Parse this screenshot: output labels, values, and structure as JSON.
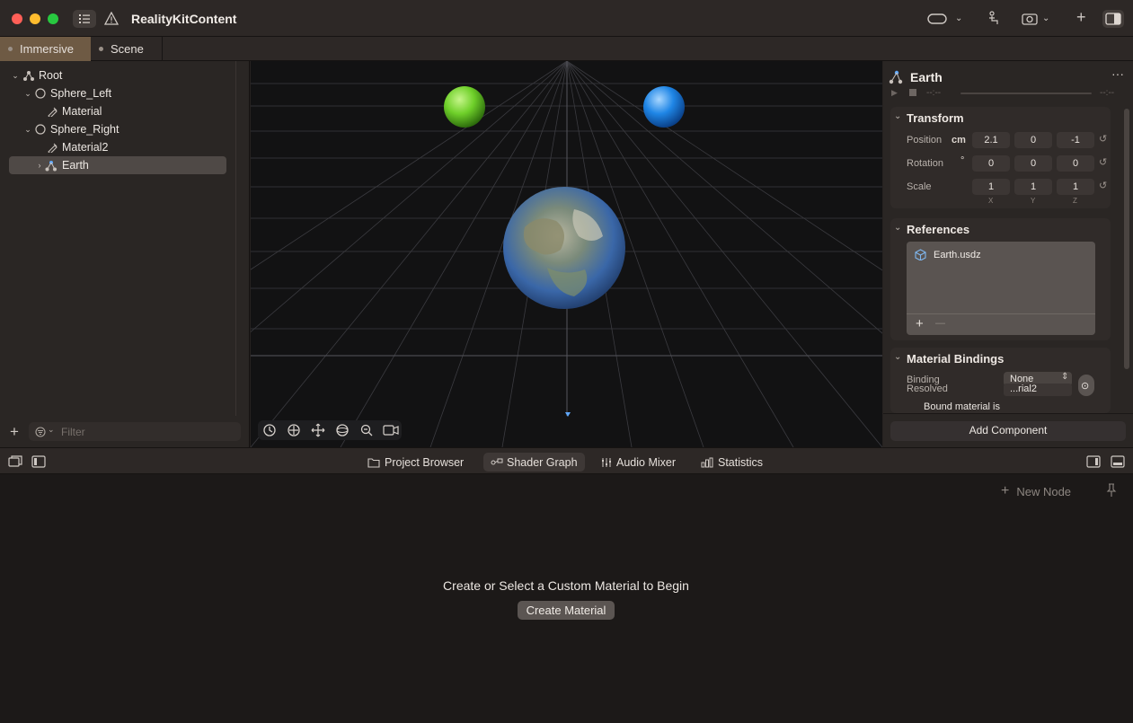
{
  "titlebar": {
    "title": "RealityKitContent",
    "traffic_colors": [
      "#ff5f57",
      "#febc2e",
      "#28c840"
    ]
  },
  "tabs": [
    {
      "label": "Immersive",
      "active": true
    },
    {
      "label": "Scene",
      "active": false
    }
  ],
  "hierarchy": {
    "items": [
      {
        "label": "Root",
        "icon": "entity-icon",
        "depth": 0,
        "expanded": true
      },
      {
        "label": "Sphere_Left",
        "icon": "sphere-icon",
        "depth": 1,
        "expanded": true
      },
      {
        "label": "Material",
        "icon": "material-icon",
        "depth": 2
      },
      {
        "label": "Sphere_Right",
        "icon": "sphere-icon",
        "depth": 1,
        "expanded": true
      },
      {
        "label": "Material2",
        "icon": "material-icon",
        "depth": 2
      },
      {
        "label": "Earth",
        "icon": "entity-icon",
        "depth": 1,
        "expanded": false,
        "selected": true
      }
    ],
    "filter_placeholder": "Filter"
  },
  "viewport": {
    "sphere_left_color": "#6fd02a",
    "sphere_right_color": "#1f86e6"
  },
  "inspector": {
    "entity_name": "Earth",
    "playback_time_start": "--:--",
    "playback_time_end": "--:--",
    "transform": {
      "title": "Transform",
      "position": {
        "label": "Position",
        "unit": "cm",
        "x": "2.1",
        "y": "0",
        "z": "-1"
      },
      "rotation": {
        "label": "Rotation",
        "unit": "°",
        "x": "0",
        "y": "0",
        "z": "0"
      },
      "scale": {
        "label": "Scale",
        "x": "1",
        "y": "1",
        "z": "1"
      },
      "axes": [
        "X",
        "Y",
        "Z"
      ]
    },
    "references": {
      "title": "References",
      "file": "Earth.usdz",
      "add": "+",
      "remove": "—"
    },
    "material_bindings": {
      "title": "Material Bindings",
      "binding_label": "Binding",
      "resolved_label": "Resolved",
      "binding_value": "None",
      "resolved_value": "...rial2",
      "note": "Bound material is"
    },
    "add_component": "Add Component"
  },
  "bottom": {
    "tabs": [
      {
        "label": "Project Browser",
        "icon": "folder-icon"
      },
      {
        "label": "Shader Graph",
        "icon": "node-graph-icon",
        "active": true
      },
      {
        "label": "Audio Mixer",
        "icon": "mixer-icon"
      },
      {
        "label": "Statistics",
        "icon": "chart-icon"
      }
    ],
    "new_node": "New Node",
    "empty_message": "Create or Select a Custom Material to Begin",
    "create_button": "Create Material"
  }
}
